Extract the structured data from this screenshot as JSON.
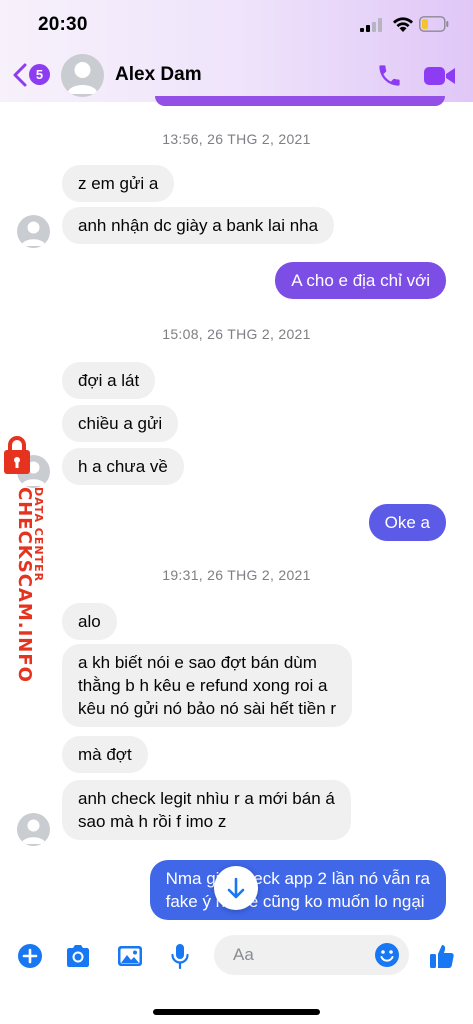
{
  "status_bar": {
    "time": "20:30"
  },
  "header": {
    "back_badge": "5",
    "contact_name": "Alex Dam"
  },
  "colors": {
    "accent": "#8d3cf3",
    "bubble_in": "#f0f0f0",
    "bubble_out_purple": "#7c4ee6",
    "bubble_out_blue": "#3f67e8",
    "blue_icon": "#1877f2"
  },
  "messages": {
    "ts1": "13:56, 26 THG 2, 2021",
    "m1": "z em gửi a",
    "m2": "anh nhận dc giày a bank lai nha",
    "m3": "A cho e địa chỉ với",
    "ts2": "15:08, 26 THG 2, 2021",
    "m4": "đợi a lát",
    "m5": "chiều a gửi",
    "m6": "h a chưa về",
    "m7": "Oke a",
    "ts3": "19:31, 26 THG 2, 2021",
    "m8": "alo",
    "m9_l1": "a kh biết nói e sao đợt bán dùm",
    "m9_l2": "thằng b h kêu e refund xong roi a",
    "m9_l3": "kêu nó gửi nó bảo nó sài hết tiền r",
    "m10": "mà đợt",
    "m11_l1": "anh check legit nhìu r a mới bán á",
    "m11_l2": "sao mà h rồi f imo z",
    "m12_l1": "Nma giờ check app 2 lần nó vẫn ra",
    "m12_l2": "fake ý nên e cũng ko muốn lo ngại"
  },
  "watermark": {
    "main": "CHECKSCAM.INFO",
    "sub": "DATA CENTER"
  },
  "composer": {
    "placeholder": "Aa"
  },
  "icons": [
    "back-icon",
    "phone-icon",
    "video-icon",
    "plus-icon",
    "camera-icon",
    "gallery-icon",
    "microphone-icon",
    "emoji-icon",
    "thumbs-up-icon",
    "arrow-down-icon",
    "lock-icon"
  ]
}
